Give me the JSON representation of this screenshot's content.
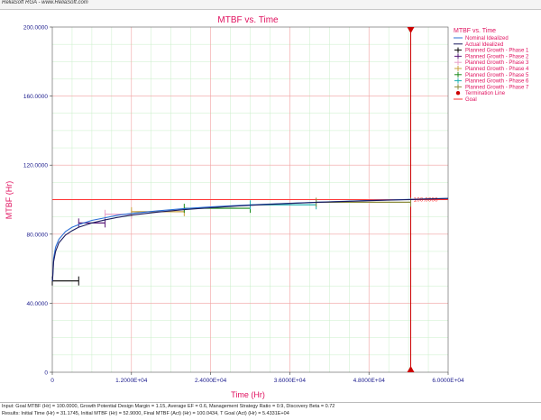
{
  "window": {
    "title": "ReliaSoft RGA - www.ReliaSoft.com"
  },
  "footer": {
    "input_line": "Input: Goal MTBF (Hr) = 100.0000, Growth Potential Design Margin = 1.15, Average EF = 0.6, Management Strategy Ratio = 0.9, Discovery Beta = 0.72",
    "results_line": "Results: Initial Time (Hr) = 31.1745, Initial MTBF (Hr) = 52.9000, Final MTBF (Act) (Hr) = 100.0434, T Goal (Act) (Hr) = 5.4331E+04"
  },
  "colors": {
    "title": "#e0115f",
    "axis_label": "#e0115f",
    "tick": "#1a1a8c",
    "grid_major": "#f2a0a0",
    "grid_minor": "#c9efc9",
    "nominal": "#2b6fd6",
    "actual": "#1a1a5e",
    "goal": "#ff3333",
    "termination": "#cc0000",
    "phase1": "#000000",
    "phase2": "#5a1b7a",
    "phase3": "#e8a0c8",
    "phase4": "#c8a23c",
    "phase5": "#1b8a1b",
    "phase6": "#20b0b0",
    "phase7": "#8a8a3a"
  },
  "chart_data": {
    "type": "line",
    "title": "MTBF vs. Time",
    "xlabel": "Time (Hr)",
    "ylabel": "MTBF (Hr)",
    "xlim": [
      0,
      60000
    ],
    "ylim": [
      0,
      200
    ],
    "x_ticks": [
      {
        "value": 0,
        "label": "0"
      },
      {
        "value": 12000,
        "label": "1.2000E+04"
      },
      {
        "value": 24000,
        "label": "2.4000E+04"
      },
      {
        "value": 36000,
        "label": "3.6000E+04"
      },
      {
        "value": 48000,
        "label": "4.8000E+04"
      },
      {
        "value": 60000,
        "label": "6.0000E+04"
      }
    ],
    "y_ticks": [
      {
        "value": 0,
        "label": "0"
      },
      {
        "value": 40,
        "label": "40.0000"
      },
      {
        "value": 80,
        "label": "80.0000"
      },
      {
        "value": 120,
        "label": "120.0000"
      },
      {
        "value": 160,
        "label": "160.0000"
      },
      {
        "value": 200,
        "label": "200.0000"
      }
    ],
    "grid": true,
    "legend_position": "right",
    "legend": {
      "title": "MTBF vs. Time",
      "entries": [
        {
          "name": "Nominal Idealized",
          "color_key": "nominal",
          "style": "line"
        },
        {
          "name": "Actual Idealized",
          "color_key": "actual",
          "style": "line"
        },
        {
          "name": "Planned Growth - Phase 1",
          "color_key": "phase1",
          "style": "cross"
        },
        {
          "name": "Planned Growth - Phase 2",
          "color_key": "phase2",
          "style": "cross"
        },
        {
          "name": "Planned Growth - Phase 3",
          "color_key": "phase3",
          "style": "cross"
        },
        {
          "name": "Planned Growth - Phase 4",
          "color_key": "phase4",
          "style": "cross"
        },
        {
          "name": "Planned Growth - Phase 5",
          "color_key": "phase5",
          "style": "cross"
        },
        {
          "name": "Planned Growth - Phase 6",
          "color_key": "phase6",
          "style": "cross"
        },
        {
          "name": "Planned Growth - Phase 7",
          "color_key": "phase7",
          "style": "cross"
        },
        {
          "name": "Termination Line",
          "color_key": "termination",
          "style": "marker"
        },
        {
          "name": "Goal",
          "color_key": "goal",
          "style": "line"
        }
      ]
    },
    "series": [
      {
        "name": "Nominal Idealized",
        "color_key": "nominal",
        "points": [
          [
            31,
            52.9
          ],
          [
            200,
            66
          ],
          [
            500,
            72.5
          ],
          [
            1000,
            77
          ],
          [
            2000,
            81.5
          ],
          [
            3000,
            84
          ],
          [
            4000,
            85.5
          ],
          [
            6000,
            88
          ],
          [
            8000,
            89.5
          ],
          [
            10000,
            91
          ],
          [
            12000,
            92
          ],
          [
            16000,
            93.5
          ],
          [
            20000,
            94.8
          ],
          [
            24000,
            95.8
          ],
          [
            28000,
            96.6
          ],
          [
            32000,
            97.3
          ],
          [
            36000,
            97.9
          ],
          [
            40000,
            98.5
          ],
          [
            44000,
            99
          ],
          [
            48000,
            99.5
          ],
          [
            52000,
            99.9
          ],
          [
            56000,
            100.3
          ],
          [
            60000,
            100.7
          ]
        ]
      },
      {
        "name": "Actual Idealized",
        "color_key": "actual",
        "points": [
          [
            31,
            52.9
          ],
          [
            200,
            64
          ],
          [
            500,
            70
          ],
          [
            1000,
            75
          ],
          [
            2000,
            79.5
          ],
          [
            3000,
            82
          ],
          [
            4000,
            84
          ],
          [
            6000,
            86.5
          ],
          [
            8000,
            88.3
          ],
          [
            10000,
            89.8
          ],
          [
            12000,
            91
          ],
          [
            16000,
            92.8
          ],
          [
            20000,
            94.2
          ],
          [
            24000,
            95.3
          ],
          [
            28000,
            96.3
          ],
          [
            32000,
            97.1
          ],
          [
            36000,
            97.8
          ],
          [
            40000,
            98.4
          ],
          [
            44000,
            98.9
          ],
          [
            48000,
            99.4
          ],
          [
            52000,
            99.8
          ],
          [
            54331,
            100.04
          ],
          [
            56000,
            100.3
          ],
          [
            60000,
            100.7
          ]
        ]
      }
    ],
    "phases": [
      {
        "name": "Planned Growth - Phase 1",
        "color_key": "phase1",
        "x_start": 0,
        "x_end": 4000,
        "mtbf": 52.9
      },
      {
        "name": "Planned Growth - Phase 2",
        "color_key": "phase2",
        "x_start": 4000,
        "x_end": 8000,
        "mtbf": 86.5
      },
      {
        "name": "Planned Growth - Phase 3",
        "color_key": "phase3",
        "x_start": 8000,
        "x_end": 12000,
        "mtbf": 91.5
      },
      {
        "name": "Planned Growth - Phase 4",
        "color_key": "phase4",
        "x_start": 12000,
        "x_end": 20000,
        "mtbf": 93
      },
      {
        "name": "Planned Growth - Phase 5",
        "color_key": "phase5",
        "x_start": 20000,
        "x_end": 30000,
        "mtbf": 95
      },
      {
        "name": "Planned Growth - Phase 6",
        "color_key": "phase6",
        "x_start": 30000,
        "x_end": 40000,
        "mtbf": 97
      },
      {
        "name": "Planned Growth - Phase 7",
        "color_key": "phase7",
        "x_start": 40000,
        "x_end": 54331,
        "mtbf": 98.5
      }
    ],
    "goal": {
      "value": 100,
      "label": "100.0000"
    },
    "termination": {
      "x": 54331
    }
  }
}
